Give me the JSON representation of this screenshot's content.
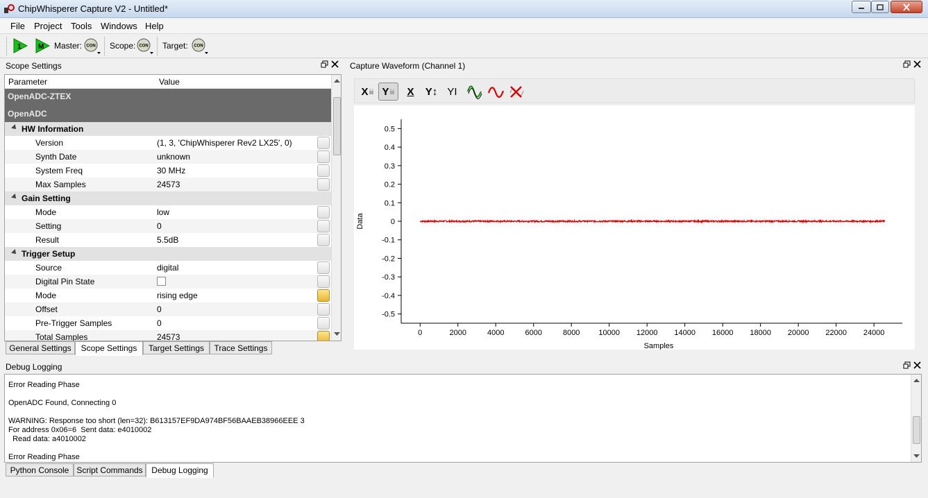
{
  "window": {
    "title": "ChipWhisperer Capture V2 - Untitled*"
  },
  "menu": [
    "File",
    "Project",
    "Tools",
    "Windows",
    "Help"
  ],
  "toolbar": {
    "btn1_label": "1",
    "btnM_label": "M",
    "master_label": "Master:",
    "scope_label": "Scope:",
    "target_label": "Target:",
    "con_label": "CON"
  },
  "scope_settings": {
    "title": "Scope Settings",
    "col_parameter": "Parameter",
    "col_value": "Value",
    "sections": [
      "OpenADC-ZTEX",
      "OpenADC"
    ],
    "groups": {
      "hw": "HW Information",
      "gain": "Gain Setting",
      "trigger": "Trigger Setup"
    },
    "rows": [
      {
        "name": "Version",
        "value": "(1, 3, 'ChipWhisperer Rev2 LX25', 0)"
      },
      {
        "name": "Synth Date",
        "value": "unknown"
      },
      {
        "name": "System Freq",
        "value": "30 MHz"
      },
      {
        "name": "Max Samples",
        "value": "24573"
      },
      {
        "name": "Mode",
        "value": "low"
      },
      {
        "name": "Setting",
        "value": "0"
      },
      {
        "name": "Result",
        "value": "5.5dB"
      },
      {
        "name": "Source",
        "value": "digital"
      },
      {
        "name": "Digital Pin State",
        "value": ""
      },
      {
        "name": "Mode",
        "value": "rising edge"
      },
      {
        "name": "Offset",
        "value": "0"
      },
      {
        "name": "Pre-Trigger Samples",
        "value": "0"
      },
      {
        "name": "Total Samples",
        "value": "24573"
      }
    ],
    "tabs": [
      "General Settings",
      "Scope Settings",
      "Target Settings",
      "Trace Settings"
    ]
  },
  "waveform": {
    "title": "Capture Waveform (Channel 1)",
    "tools": {
      "x_lock": "X",
      "y_lock": "Y",
      "x_autoscale": "X",
      "y_autoscale": "Y↕",
      "y_default": "YI"
    }
  },
  "chart_data": {
    "type": "line",
    "xlabel": "Samples",
    "ylabel": "Data",
    "xlim": [
      -1000,
      25500
    ],
    "ylim": [
      -0.55,
      0.55
    ],
    "xticks": [
      0,
      2000,
      4000,
      6000,
      8000,
      10000,
      12000,
      14000,
      16000,
      18000,
      20000,
      22000,
      24000
    ],
    "yticks": [
      0.5,
      0.4,
      0.3,
      0.2,
      0.1,
      0,
      -0.1,
      -0.2,
      -0.3,
      -0.4,
      -0.5
    ],
    "series": [
      {
        "color": "#e00000",
        "x_range": [
          0,
          24573
        ],
        "approx_value": 0,
        "noise_amplitude": 0.004
      }
    ]
  },
  "debug": {
    "title": "Debug Logging",
    "lines": [
      "Error Reading Phase",
      "",
      "OpenADC Found, Connecting 0",
      "",
      "WARNING: Response too short (len=32): B613157EF9DA974BF56BAAEB38966EEE 3",
      "For address 0x06=6  Sent data: e4010002",
      "  Read data: a4010002",
      "",
      "Error Reading Phase"
    ],
    "tabs": [
      "Python Console",
      "Script Commands",
      "Debug Logging"
    ]
  }
}
